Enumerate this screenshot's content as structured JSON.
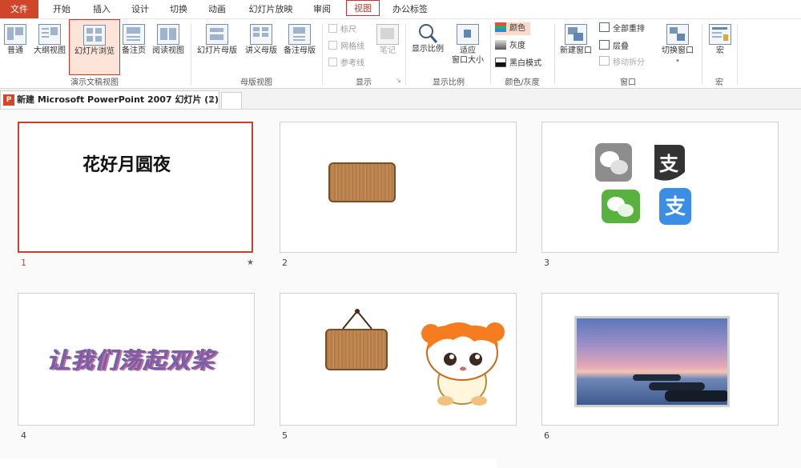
{
  "menu": {
    "file": "文件",
    "tabs": [
      "开始",
      "插入",
      "设计",
      "切换",
      "动画",
      "幻灯片放映",
      "审阅",
      "视图",
      "办公标签"
    ]
  },
  "ribbon": {
    "presentation_views": {
      "label": "演示文稿视图",
      "buttons": [
        "普通",
        "大纲视图",
        "幻灯片浏览",
        "备注页",
        "阅读视图"
      ]
    },
    "master_views": {
      "label": "母版视图",
      "buttons": [
        "幻灯片母版",
        "讲义母版",
        "备注母版"
      ]
    },
    "show": {
      "label": "显示",
      "checks": [
        "标尺",
        "网格线",
        "参考线"
      ],
      "notes": "笔记"
    },
    "zoom": {
      "label": "显示比例",
      "zoom_btn": "显示比例",
      "fit_btn_line1": "适应",
      "fit_btn_line2": "窗口大小"
    },
    "color": {
      "label": "颜色/灰度",
      "modes": [
        "颜色",
        "灰度",
        "黑白模式"
      ]
    },
    "window": {
      "label": "窗口",
      "new_window": "新建窗口",
      "arrange_all": "全部重排",
      "cascade": "层叠",
      "move_split": "移动拆分",
      "switch_window": "切换窗口"
    },
    "macros": {
      "label": "宏",
      "button": "宏"
    }
  },
  "doc_tab": {
    "title": "新建 Microsoft PowerPoint 2007 幻灯片 (2)",
    "close": "×"
  },
  "slides": [
    {
      "num": "1",
      "title": "花好月圆夜",
      "star": "★"
    },
    {
      "num": "2"
    },
    {
      "num": "3"
    },
    {
      "num": "4",
      "text": "让我们荡起双桨"
    },
    {
      "num": "5"
    },
    {
      "num": "6"
    }
  ],
  "colors": {
    "accent": "#d0462a",
    "highlight_box": "#d32f2f",
    "selected_slide_border": "#c9422a"
  }
}
